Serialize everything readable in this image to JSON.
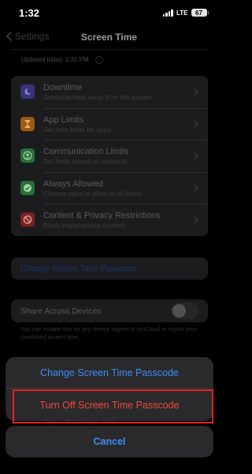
{
  "status_bar": {
    "time": "1:32",
    "network": "LTE",
    "battery": "67"
  },
  "nav": {
    "back_label": "Settings",
    "title": "Screen Time"
  },
  "updated": {
    "text": "Updated today, 1:31 PM"
  },
  "items": [
    {
      "title": "Downtime",
      "subtitle": "Schedule time away from the screen.",
      "icon": "moon-icon",
      "color": "#38337a"
    },
    {
      "title": "App Limits",
      "subtitle": "Set time limits for apps.",
      "icon": "hourglass-icon",
      "color": "#9a5a12"
    },
    {
      "title": "Communication Limits",
      "subtitle": "Set limits based on contacts.",
      "icon": "contact-icon",
      "color": "#2a6e3a"
    },
    {
      "title": "Always Allowed",
      "subtitle": "Choose apps to allow at all times.",
      "icon": "checkmark-icon",
      "color": "#2a6e3a"
    },
    {
      "title": "Content & Privacy Restrictions",
      "subtitle": "Block inappropriate content.",
      "icon": "no-entry-icon",
      "color": "#7a2222"
    }
  ],
  "change_passcode_link": "Change Screen Time Passcode",
  "share": {
    "label": "Share Across Devices",
    "enabled": false
  },
  "footnote": "You can enable this on any device signed in to iCloud to report your combined screen time.",
  "action_sheet": {
    "change_label": "Change Screen Time Passcode",
    "turn_off_label": "Turn Off Screen Time Passcode",
    "cancel_label": "Cancel"
  },
  "background_hint": "Turn Off Screen Time",
  "colors": {
    "accent": "#3f8cf6",
    "destructive": "#f3473c",
    "highlight": "#e52222"
  }
}
